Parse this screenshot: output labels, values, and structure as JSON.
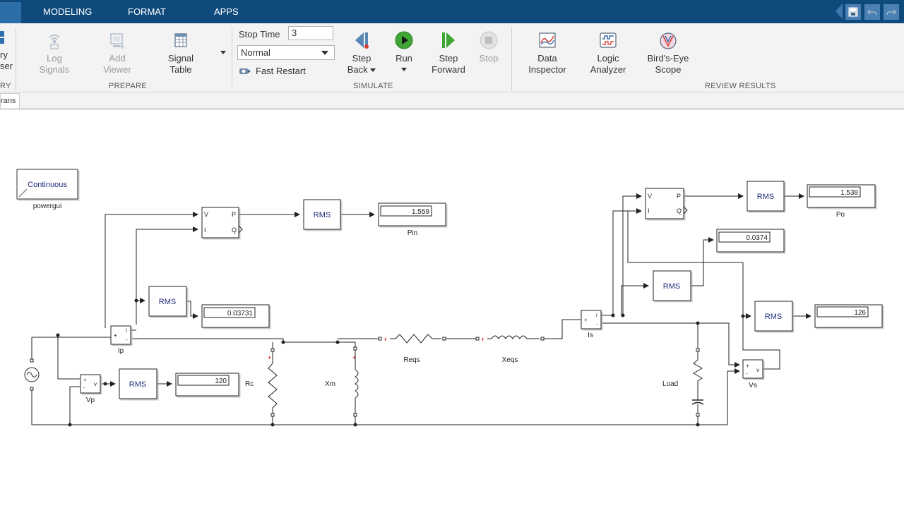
{
  "menu": {
    "tabs": [
      "MODELING",
      "FORMAT",
      "APPS"
    ]
  },
  "ribbon": {
    "library_partial": [
      "ry",
      "ser"
    ],
    "library_section_partial": "RY",
    "prepare": {
      "log_signals": [
        "Log",
        "Signals"
      ],
      "add_viewer": [
        "Add",
        "Viewer"
      ],
      "signal_table": [
        "Signal",
        "Table"
      ],
      "label": "PREPARE"
    },
    "simulate": {
      "stop_time_label": "Stop Time",
      "stop_time_value": "3",
      "mode": "Normal",
      "fast_restart": "Fast Restart",
      "step_back": [
        "Step",
        "Back"
      ],
      "run": "Run",
      "step_forward": [
        "Step",
        "Forward"
      ],
      "stop": "Stop",
      "label": "SIMULATE"
    },
    "review": {
      "data_inspector": [
        "Data",
        "Inspector"
      ],
      "logic_analyzer": [
        "Logic",
        "Analyzer"
      ],
      "birds_eye": [
        "Bird's-Eye",
        "Scope"
      ],
      "label": "REVIEW RESULTS"
    }
  },
  "breadcrumb": {
    "model_tab": "rans"
  },
  "model": {
    "powergui_block": "Continuous",
    "powergui_label": "powergui",
    "rms_label": "RMS",
    "pq_ports": {
      "v": "V",
      "i": "I",
      "p": "P",
      "q": "Q"
    },
    "displays": {
      "pin_value": "1.559",
      "pin_label": "Pin",
      "ip_rms_value": "0.03731",
      "vp_rms_value": "120",
      "po_value": "1.538",
      "po_label": "Po",
      "is_rms_value": "0.0374",
      "vs_rms_value": "126"
    },
    "labels": {
      "ip": "Ip",
      "vp": "Vp",
      "is": "Is",
      "vs": "Vs",
      "rc": "Rc",
      "xm": "Xm",
      "reqs": "Reqs",
      "xeqs": "Xeqs",
      "load": "Load"
    },
    "colors": {
      "block_text": "#1f2d7a",
      "wire": "#222222"
    }
  }
}
